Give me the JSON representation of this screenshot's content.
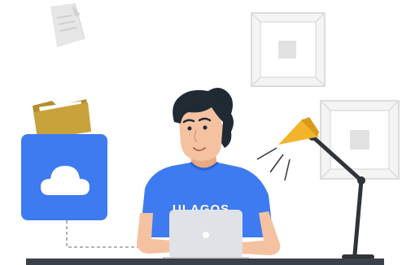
{
  "illustration": {
    "shirt_text": "ULAGOS",
    "colors": {
      "accent_blue": "#3e7af0",
      "folder_gold": "#c8a23a",
      "lamp_yellow": "#f2b42a",
      "desk_dark": "#3b4148",
      "skin": "#f4c2a1",
      "hair": "#1f2a33",
      "laptop_grey": "#dfe2e6",
      "frame_grey": "#ececec"
    },
    "icons": [
      "document-icon",
      "folder-icon",
      "cloud-icon",
      "desk-lamp-icon",
      "picture-frame-icon",
      "laptop-icon"
    ]
  }
}
